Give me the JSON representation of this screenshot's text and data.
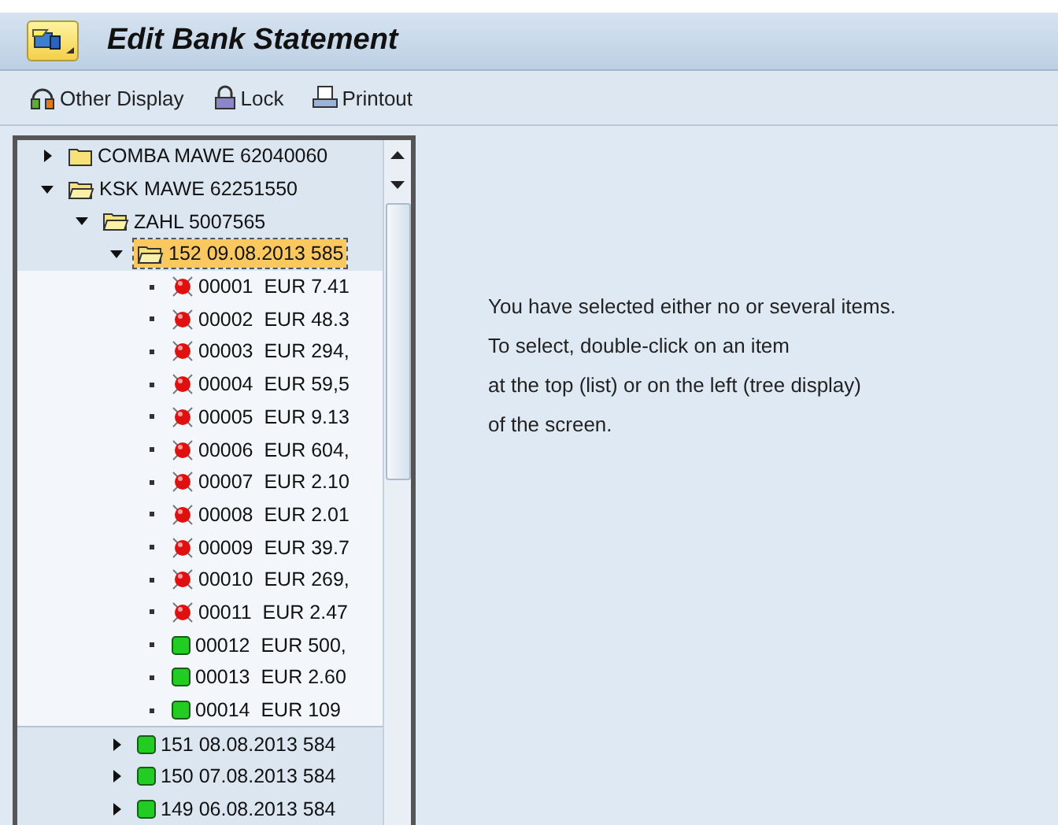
{
  "window": {
    "title": "Edit Bank Statement"
  },
  "toolbar": [
    {
      "label": "Other Display"
    },
    {
      "label": "Lock"
    },
    {
      "label": "Printout"
    }
  ],
  "tree": [
    {
      "label": "COMBA MAWE 62040060",
      "kind": "folder",
      "expanded": false,
      "selected": false
    },
    {
      "label": "KSK MAWE 62251550",
      "kind": "folder_open",
      "expanded": true,
      "selected": false,
      "children": [
        {
          "label": "ZAHL 5007565",
          "kind": "folder_open",
          "expanded": true,
          "selected": false,
          "children": [
            {
              "label": "152 09.08.2013 585",
              "kind": "folder_open",
              "expanded": true,
              "selected": true,
              "children": [
                {
                  "label": "00001  EUR 7.41",
                  "kind": "error",
                  "selected": false
                },
                {
                  "label": "00002  EUR 48.3",
                  "kind": "error",
                  "selected": false
                },
                {
                  "label": "00003  EUR 294,",
                  "kind": "error",
                  "selected": false
                },
                {
                  "label": "00004  EUR 59,5",
                  "kind": "error",
                  "selected": false
                },
                {
                  "label": "00005  EUR 9.13",
                  "kind": "error",
                  "selected": false
                },
                {
                  "label": "00006  EUR 604,",
                  "kind": "error",
                  "selected": false
                },
                {
                  "label": "00007  EUR 2.10",
                  "kind": "error",
                  "selected": false
                },
                {
                  "label": "00008  EUR 2.01",
                  "kind": "error",
                  "selected": false
                },
                {
                  "label": "00009  EUR 39.7",
                  "kind": "error",
                  "selected": false
                },
                {
                  "label": "00010  EUR 269,",
                  "kind": "error",
                  "selected": false
                },
                {
                  "label": "00011  EUR 2.47",
                  "kind": "error",
                  "selected": false
                },
                {
                  "label": "00012  EUR 500,",
                  "kind": "ok",
                  "selected": false
                },
                {
                  "label": "00013  EUR 2.60",
                  "kind": "ok",
                  "selected": false
                },
                {
                  "label": "00014  EUR 109",
                  "kind": "ok",
                  "selected": false
                }
              ]
            },
            {
              "label": "151 08.08.2013 584",
              "kind": "ok",
              "expanded": false,
              "selected": false
            },
            {
              "label": "150 07.08.2013 584",
              "kind": "ok",
              "expanded": false,
              "selected": false
            },
            {
              "label": "149 06.08.2013 584",
              "kind": "ok",
              "expanded": false,
              "selected": false
            }
          ]
        }
      ]
    }
  ],
  "message": [
    "You have selected either no or several items.",
    "To select, double-click on an item",
    "at the top (list) or on the left (tree display)",
    "of the screen."
  ]
}
